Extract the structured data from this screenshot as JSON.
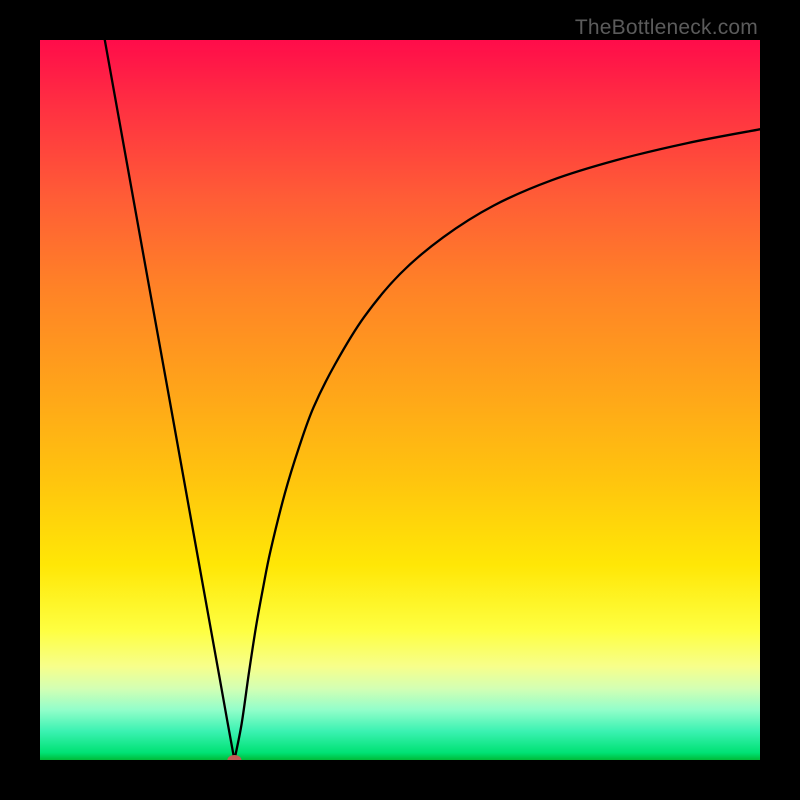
{
  "watermark": "TheBottleneck.com",
  "marker": {
    "color": "#c45a54",
    "rx": 7,
    "ry": 5
  },
  "chart_data": {
    "type": "line",
    "title": "",
    "xlabel": "",
    "ylabel": "",
    "xlim": [
      0,
      100
    ],
    "ylim": [
      0,
      100
    ],
    "minimum_point": {
      "x": 27,
      "y": 0
    },
    "series": [
      {
        "name": "left-branch",
        "x": [
          9,
          12,
          15,
          18,
          21,
          23,
          25,
          26,
          27
        ],
        "values": [
          100,
          83.3,
          66.6,
          50.0,
          33.3,
          22.2,
          11.1,
          5.5,
          0
        ]
      },
      {
        "name": "right-branch",
        "x": [
          27,
          28,
          29,
          30,
          31,
          32,
          34,
          36,
          38,
          41,
          45,
          50,
          56,
          63,
          71,
          80,
          90,
          100
        ],
        "values": [
          0,
          5,
          12,
          18.5,
          24,
          29,
          37,
          43.5,
          49,
          55,
          61.5,
          67.5,
          72.6,
          77,
          80.5,
          83.3,
          85.7,
          87.6
        ]
      }
    ]
  }
}
